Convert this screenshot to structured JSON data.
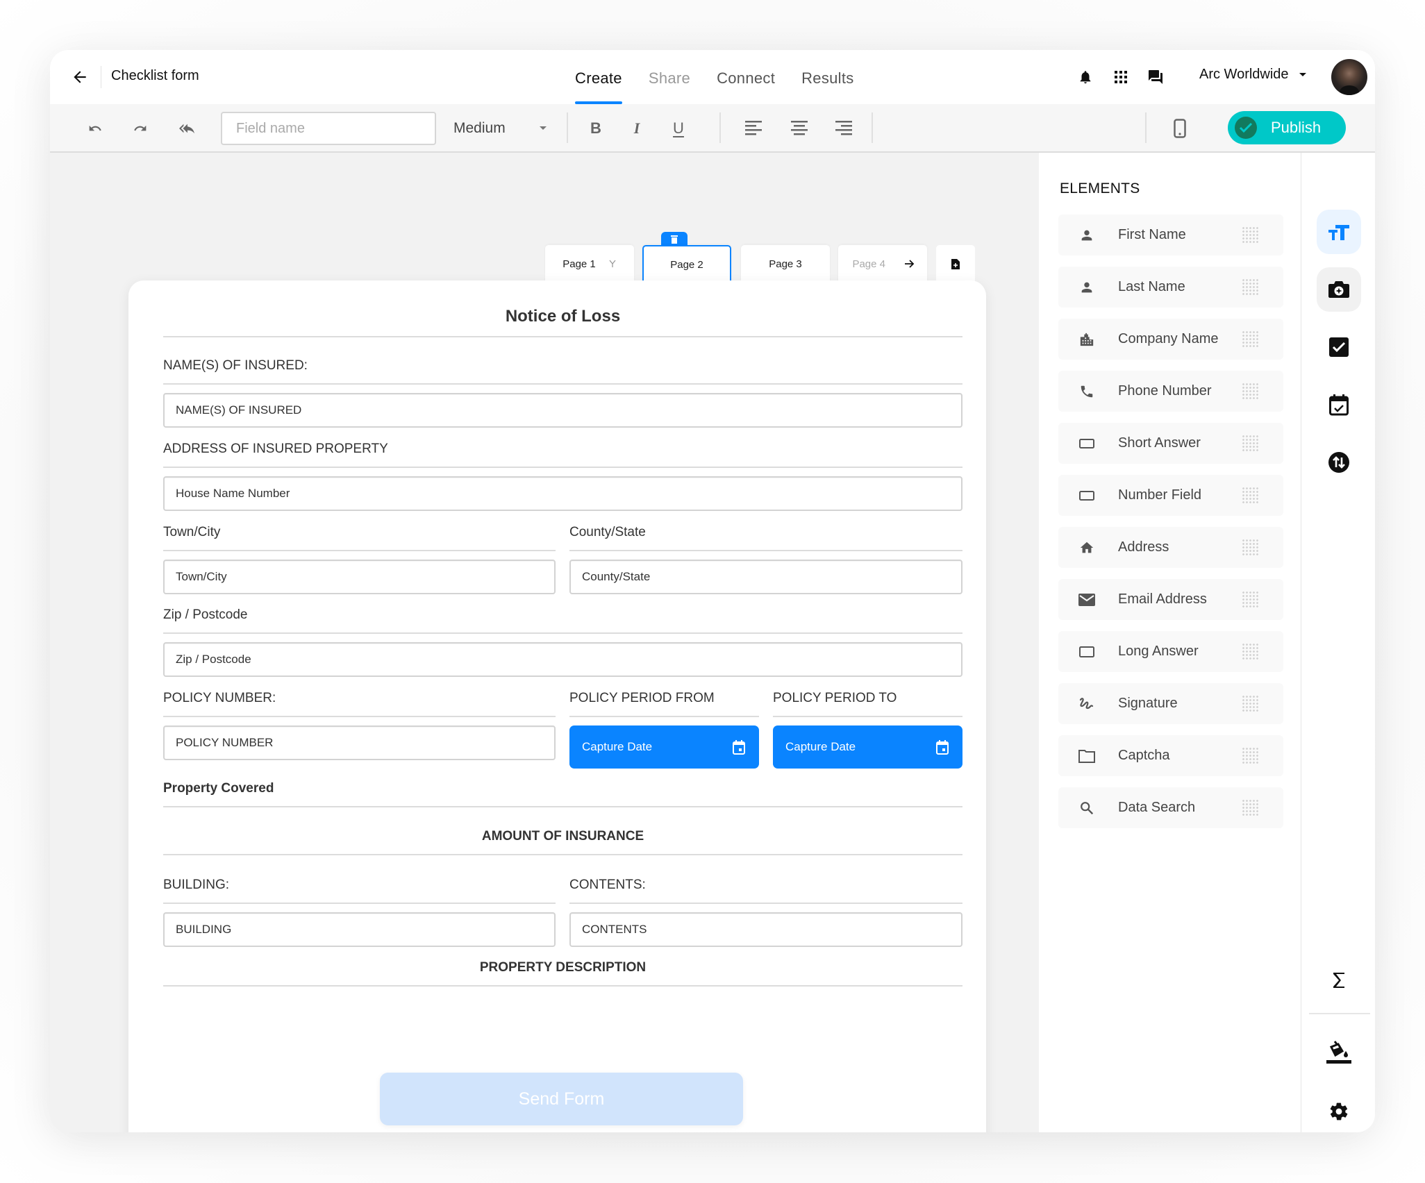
{
  "header": {
    "title": "Checklist form",
    "tabs": [
      {
        "label": "Create",
        "state": "active"
      },
      {
        "label": "Share",
        "state": "muted"
      },
      {
        "label": "Connect",
        "state": "normal"
      },
      {
        "label": "Results",
        "state": "normal"
      }
    ],
    "organization": "Arc Worldwide",
    "icons": [
      "back-arrow-icon",
      "bell-icon",
      "apps-grid-icon",
      "chat-icon",
      "chevron-down-icon",
      "avatar"
    ]
  },
  "toolbar": {
    "field_name_placeholder": "Field name",
    "field_name_value": "",
    "size_selected": "Medium",
    "buttons": [
      "undo",
      "redo",
      "reply-all",
      "bold",
      "italic",
      "underline",
      "align-left",
      "align-center",
      "align-right",
      "mobile-preview"
    ],
    "bold_glyph": "B",
    "italic_glyph": "I",
    "underline_glyph": "U",
    "publish_label": "Publish",
    "publish_color": "#00c8c8"
  },
  "pages": {
    "tabs": [
      {
        "label": "Page 1",
        "state": "normal",
        "icon": "branch-icon"
      },
      {
        "label": "Page 2",
        "state": "active"
      },
      {
        "label": "Page 3",
        "state": "normal"
      },
      {
        "label": "Page 4",
        "state": "dim",
        "icon": "arrow-right-icon"
      }
    ],
    "add_page_icon": "add-page-icon",
    "delete_icon": "trash-icon"
  },
  "form": {
    "title": "Notice of Loss",
    "name_label": "NAME(S) OF INSURED:",
    "name_placeholder": "NAME(S) OF INSURED",
    "address_label": "ADDRESS OF INSURED PROPERTY",
    "house_placeholder": "House Name Number",
    "town_label": "Town/City",
    "town_placeholder": "Town/City",
    "county_label": "County/State",
    "county_placeholder": "County/State",
    "zip_label": "Zip / Postcode",
    "zip_placeholder": "Zip / Postcode",
    "policy_label": "POLICY NUMBER:",
    "policy_placeholder": "POLICY NUMBER",
    "period_from_label": "POLICY PERIOD FROM",
    "period_to_label": "POLICY PERIOD TO",
    "capture_date_label": "Capture Date",
    "property_covered_label": "Property Covered",
    "amount_heading": "AMOUNT OF INSURANCE",
    "building_label": "BUILDING:",
    "building_placeholder": "BUILDING",
    "contents_label": "CONTENTS:",
    "contents_placeholder": "CONTENTS",
    "property_description_heading": "PROPERTY DESCRIPTION",
    "send_label": "Send Form",
    "accent_color": "#0a84ff"
  },
  "elements_panel": {
    "title": "ELEMENTS",
    "items": [
      {
        "label": "First Name",
        "icon": "person-icon"
      },
      {
        "label": "Last Name",
        "icon": "person-icon"
      },
      {
        "label": "Company Name",
        "icon": "building-icon"
      },
      {
        "label": "Phone Number",
        "icon": "phone-icon"
      },
      {
        "label": "Short Answer",
        "icon": "input-box-icon"
      },
      {
        "label": "Number Field",
        "icon": "input-box-icon"
      },
      {
        "label": "Address",
        "icon": "home-icon"
      },
      {
        "label": "Email Address",
        "icon": "mail-icon"
      },
      {
        "label": "Long Answer",
        "icon": "input-box-icon"
      },
      {
        "label": "Signature",
        "icon": "signature-icon"
      },
      {
        "label": "Captcha",
        "icon": "folder-icon"
      },
      {
        "label": "Data Search",
        "icon": "search-icon"
      }
    ]
  },
  "rail": {
    "items": [
      {
        "name": "text-format-icon",
        "state": "active"
      },
      {
        "name": "camera-icon",
        "state": "hover"
      },
      {
        "name": "checkbox-icon",
        "state": "normal"
      },
      {
        "name": "calendar-check-icon",
        "state": "normal"
      },
      {
        "name": "swap-vertical-icon",
        "state": "normal"
      },
      {
        "name": "sigma-icon",
        "state": "normal"
      },
      {
        "name": "paint-bucket-icon",
        "state": "normal"
      },
      {
        "name": "settings-icon",
        "state": "normal"
      }
    ]
  }
}
